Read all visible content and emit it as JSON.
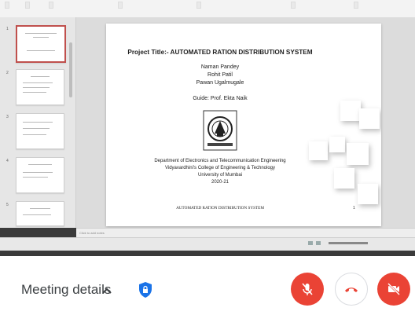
{
  "colors": {
    "danger": "#ea4335",
    "shield": "#1a73e8"
  },
  "slide": {
    "title": "Project Title:- AUTOMATED RATION DISTRIBUTION SYSTEM",
    "members": [
      "Naman Pandey",
      "Rohit Patil",
      "Pawan Ugalmugale"
    ],
    "guide": "Guide: Prof. Ekta Naik",
    "dept": "Department of Electronics and Telecommunication Engineering",
    "college": "Vidyavardhini's College of Engineering & Technology",
    "university": "University of Mumbai",
    "year": "2020-21",
    "footer": "AUTOMATED RATION DISTRIBUTION SYSTEM",
    "page_number": "1"
  },
  "editor": {
    "notes_placeholder": "Click to add notes"
  },
  "meeting": {
    "details_label": "Meeting details",
    "icons": [
      "chevron-up-icon",
      "shield-lock-icon",
      "mic-off-icon",
      "end-call-icon",
      "camera-off-icon"
    ]
  }
}
